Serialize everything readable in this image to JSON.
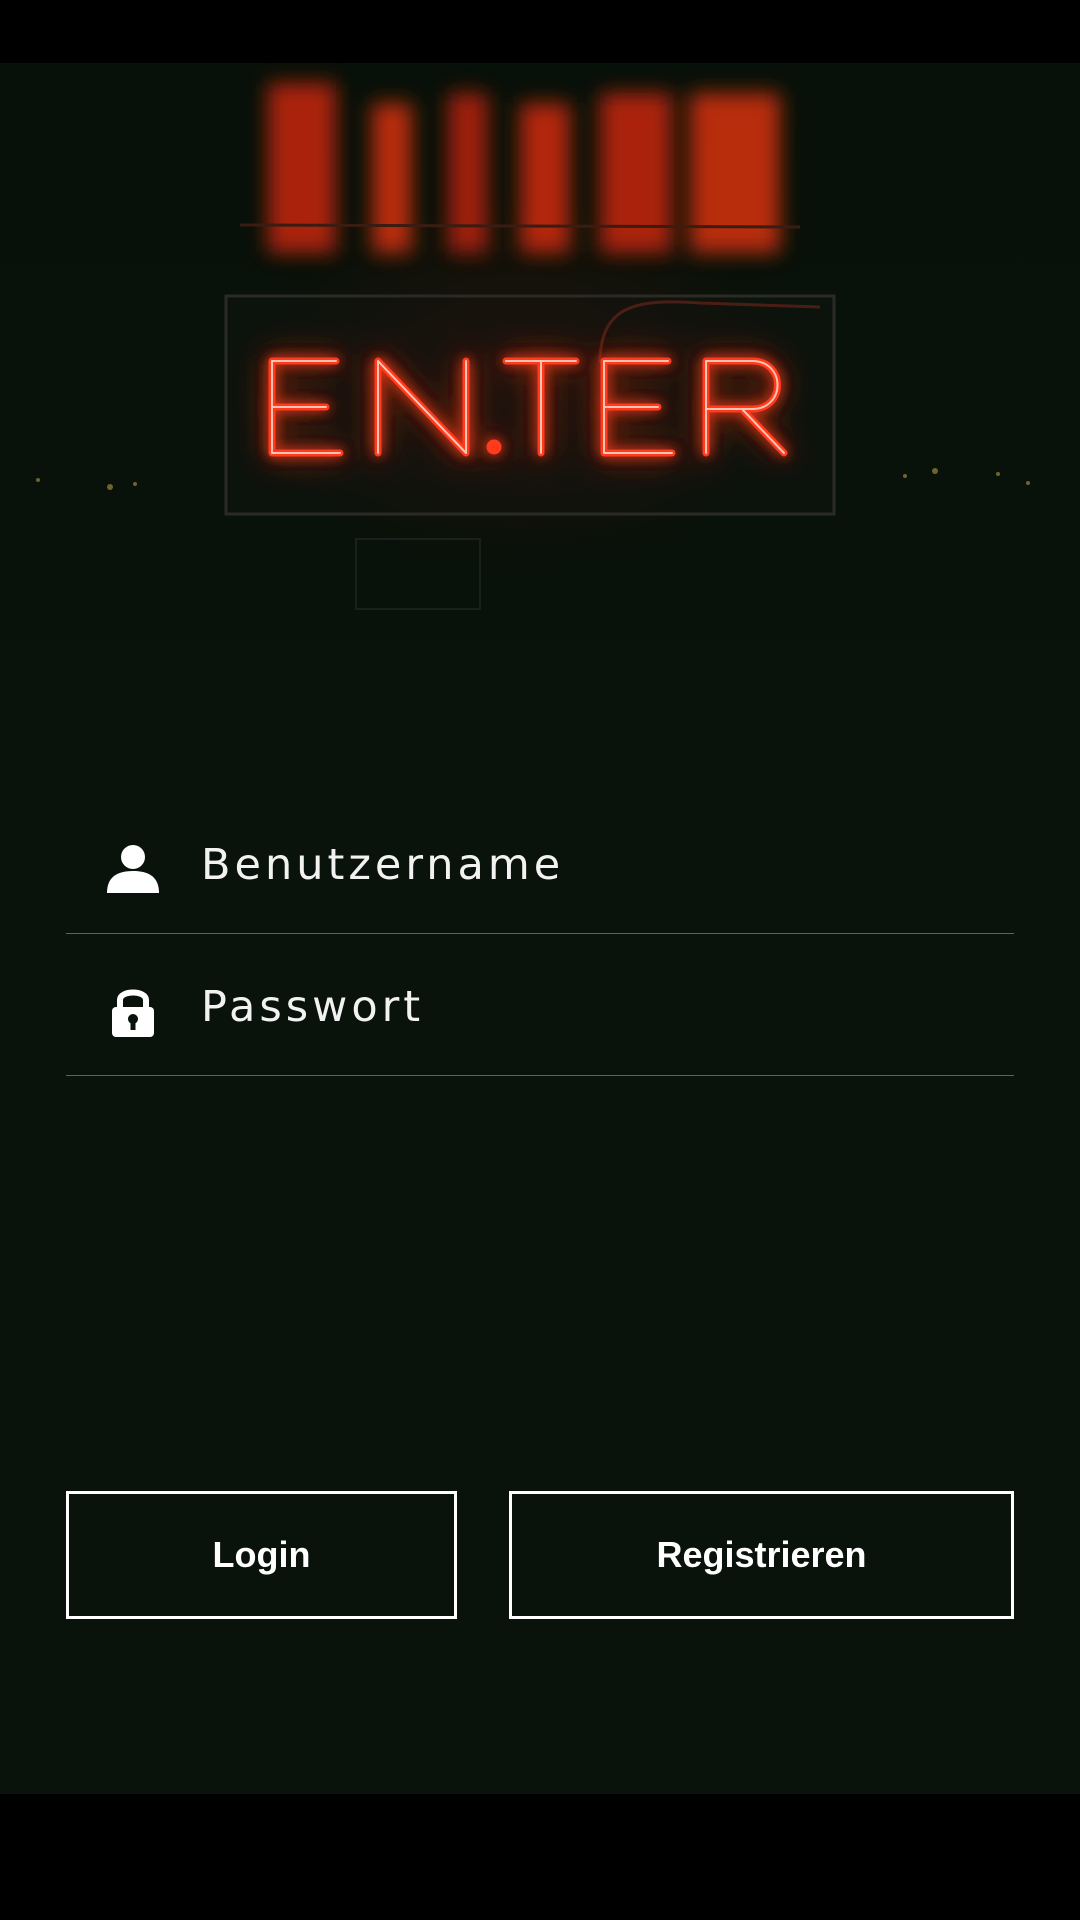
{
  "hero": {
    "sign_text": "EN.TER",
    "neon_color": "#ff3a1a",
    "icon": "neon-enter-sign"
  },
  "form": {
    "username": {
      "placeholder": "Benutzername",
      "value": "",
      "icon": "person-icon"
    },
    "password": {
      "placeholder": "Passwort",
      "value": "",
      "icon": "lock-icon"
    }
  },
  "buttons": {
    "login_label": "Login",
    "register_label": "Registrieren"
  },
  "colors": {
    "background": "#09120b",
    "text": "#ffffff",
    "divider": "#5c625e"
  }
}
